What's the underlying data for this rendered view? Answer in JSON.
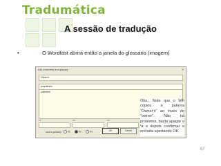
{
  "brand": "Tradumática",
  "slide": {
    "title": "A sessão de tradução",
    "bullet": "O Wordfast abrirá então a janela do glossário (imagem)",
    "page_number": "67"
  },
  "dialog": {
    "title": "Add a new entry to a glossary",
    "fields": [
      {
        "label": "",
        "value": "Owner's"
      },
      {
        "label": "",
        "value": "proprietário"
      },
      {
        "label": "",
        "value": "comment"
      }
    ],
    "small_labels": [
      "T1",
      "T2",
      "T3"
    ],
    "add_to_glossary_label": "Add to glossary:",
    "radios": [
      {
        "label": "#1",
        "selected": false
      },
      {
        "label": "#2",
        "selected": true
      },
      {
        "label": "#3",
        "selected": false
      }
    ],
    "ok_label": "OK",
    "cancel_label": "Cancel"
  },
  "note": {
    "text_before": "Obs.: Note que o WF copiou a palavra \"Owner's\" ao invés de \"owner\". Não há problema, basta apagar o ",
    "bold": "'s",
    "text_after": " e depois confirmar a entrada apertando OK."
  },
  "colors": {
    "brand": "#7fb33c",
    "dialog_bg": "#ece9d8",
    "input_bg": "#fffff2"
  }
}
